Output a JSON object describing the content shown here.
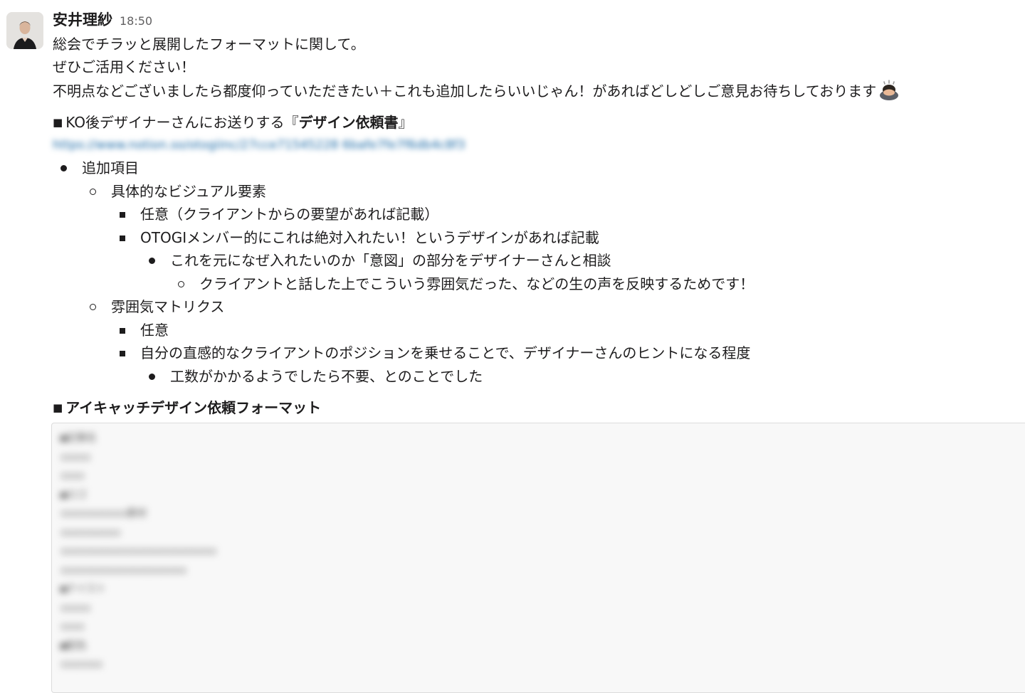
{
  "message": {
    "sender": "安井理紗",
    "timestamp": "18:50",
    "lines": [
      "総会でチラッと展開したフォーマットに関して。",
      "ぜひご活用ください！",
      "不明点などございましたら都度仰っていただきたい＋これも追加したらいいじゃん！があればどしどしご意見お待ちしております"
    ],
    "emoji_icon": "bowing-person-emoji"
  },
  "section1": {
    "marker": "■",
    "title_plain": "KO後デザイナーさんにお送りする『",
    "title_bold": "デザイン依頼書",
    "title_end": "』",
    "link_text": "https://www.notion.so/otogiinc/27cce71545228 6bafe7fe7f6db4c8f3"
  },
  "list": {
    "item1": "追加項目",
    "item1_1": "具体的なビジュアル要素",
    "item1_1_1": "任意（クライアントからの要望があれば記載）",
    "item1_1_2": "OTOGIメンバー的にこれは絶対入れたい！というデザインがあれば記載",
    "item1_1_2_1": "これを元になぜ入れたいのか「意図」の部分をデザイナーさんと相談",
    "item1_1_2_1_1": "クライアントと話した上でこういう雰囲気だった、などの生の声を反映するためです！",
    "item1_2": "雰囲気マトリクス",
    "item1_2_1": "任意",
    "item1_2_2": "自分の直感的なクライアントのポジションを乗せることで、デザイナーさんのヒントになる程度",
    "item1_2_2_1": "工数がかかるようでしたら不要、とのことでした"
  },
  "section2": {
    "marker": "■",
    "title": "アイキャッチデザイン依頼フォーマット",
    "code_lines": [
      "■記事名",
      "xxxxx",
      "xxxx",
      "■ロゴ",
      "xxxxxxxxxxx素材",
      "xxxxxxxxxx",
      "xxxxxxxxxxxxxxxxxxxxxxxxxx",
      "xxxxxxxxxxxxxxxxxxxxx",
      "■テイスト",
      "xxxxx",
      "xxxx",
      "■配色",
      "xxxxxxx"
    ]
  }
}
